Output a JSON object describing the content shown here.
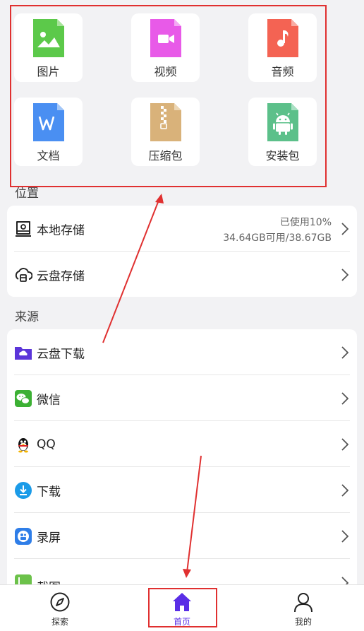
{
  "categories": [
    {
      "label": "图片",
      "icon": "image-file-icon",
      "color": "#5cc94a"
    },
    {
      "label": "视频",
      "icon": "video-file-icon",
      "color": "#e85ae8"
    },
    {
      "label": "音频",
      "icon": "audio-file-icon",
      "color": "#f46353"
    },
    {
      "label": "文档",
      "icon": "document-file-icon",
      "color": "#4a8ff2"
    },
    {
      "label": "压缩包",
      "icon": "zip-file-icon",
      "color": "#d9b27a"
    },
    {
      "label": "安装包",
      "icon": "apk-file-icon",
      "color": "#5cc08a"
    }
  ],
  "location": {
    "title": "位置",
    "local": {
      "label": "本地存储",
      "used": "已使用10%",
      "capacity": "34.64GB可用/38.67GB"
    },
    "cloud": {
      "label": "云盘存储"
    }
  },
  "source": {
    "title": "来源",
    "items": [
      {
        "label": "云盘下载",
        "icon": "cloud-download-folder-icon"
      },
      {
        "label": "微信",
        "icon": "wechat-icon"
      },
      {
        "label": "QQ",
        "icon": "qq-penguin-icon"
      },
      {
        "label": "下载",
        "icon": "download-icon"
      },
      {
        "label": "录屏",
        "icon": "screen-record-icon"
      },
      {
        "label": "截图",
        "icon": "screenshot-icon"
      }
    ]
  },
  "nav": {
    "explore": "探索",
    "home": "首页",
    "mine": "我的"
  },
  "colors": {
    "accent": "#5a2ee6",
    "annotation": "#e03030",
    "background": "#f2f2f4"
  }
}
